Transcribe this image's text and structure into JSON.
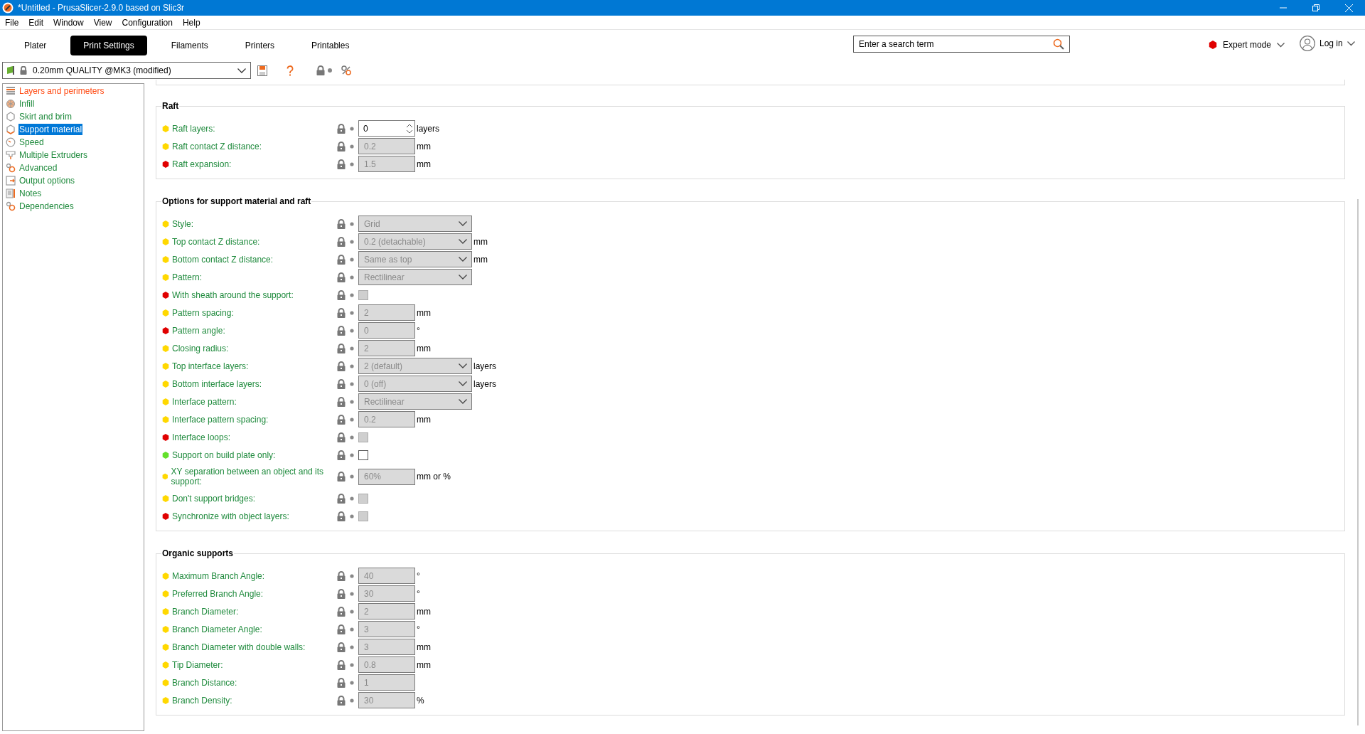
{
  "window": {
    "title": "*Untitled - PrusaSlicer-2.9.0 based on Slic3r"
  },
  "menu": [
    "File",
    "Edit",
    "Window",
    "View",
    "Configuration",
    "Help"
  ],
  "tabs": [
    {
      "label": "Plater",
      "selected": false
    },
    {
      "label": "Print Settings",
      "selected": true
    },
    {
      "label": "Filaments",
      "selected": false
    },
    {
      "label": "Printers",
      "selected": false
    },
    {
      "label": "Printables",
      "selected": false
    }
  ],
  "search": {
    "placeholder": "Enter a search term"
  },
  "mode": {
    "label": "Expert mode",
    "color": "#e00000"
  },
  "account": {
    "label": "Log in"
  },
  "preset": {
    "value": "0.20mm QUALITY @MK3 (modified)"
  },
  "sidebar": {
    "items": [
      {
        "label": "Layers and perimeters",
        "modified": true,
        "selected": false
      },
      {
        "label": "Infill",
        "modified": false,
        "selected": false
      },
      {
        "label": "Skirt and brim",
        "modified": false,
        "selected": false
      },
      {
        "label": "Support material",
        "modified": false,
        "selected": true
      },
      {
        "label": "Speed",
        "modified": false,
        "selected": false
      },
      {
        "label": "Multiple Extruders",
        "modified": false,
        "selected": false
      },
      {
        "label": "Advanced",
        "modified": false,
        "selected": false
      },
      {
        "label": "Output options",
        "modified": false,
        "selected": false
      },
      {
        "label": "Notes",
        "modified": false,
        "selected": false
      },
      {
        "label": "Dependencies",
        "modified": false,
        "selected": false
      }
    ]
  },
  "sections": [
    {
      "title": "Raft",
      "rows": [
        {
          "label": "Raft layers:",
          "color": "#ffd800",
          "kind": "spin",
          "value": "0",
          "unit": "layers",
          "disabled": false
        },
        {
          "label": "Raft contact Z distance:",
          "color": "#ffd800",
          "kind": "text",
          "value": "0.2",
          "unit": "mm",
          "disabled": true
        },
        {
          "label": "Raft expansion:",
          "color": "#e00000",
          "kind": "text",
          "value": "1.5",
          "unit": "mm",
          "disabled": true
        }
      ]
    },
    {
      "title": "Options for support material and raft",
      "rows": [
        {
          "label": "Style:",
          "color": "#ffd800",
          "kind": "select",
          "value": "Grid",
          "disabled": true
        },
        {
          "label": "Top contact Z distance:",
          "color": "#ffd800",
          "kind": "select",
          "value": "0.2 (detachable)",
          "unit": "mm",
          "disabled": true
        },
        {
          "label": "Bottom contact Z distance:",
          "color": "#ffd800",
          "kind": "select",
          "value": "Same as top",
          "unit": "mm",
          "disabled": true
        },
        {
          "label": "Pattern:",
          "color": "#ffd800",
          "kind": "select",
          "value": "Rectilinear",
          "disabled": true
        },
        {
          "label": "With sheath around the support:",
          "color": "#e00000",
          "kind": "checkbox",
          "checked": false,
          "disabled": true
        },
        {
          "label": "Pattern spacing:",
          "color": "#ffd800",
          "kind": "text",
          "value": "2",
          "unit": "mm",
          "disabled": true
        },
        {
          "label": "Pattern angle:",
          "color": "#e00000",
          "kind": "text",
          "value": "0",
          "unit": "°",
          "disabled": true
        },
        {
          "label": "Closing radius:",
          "color": "#ffd800",
          "kind": "text",
          "value": "2",
          "unit": "mm",
          "disabled": true
        },
        {
          "label": "Top interface layers:",
          "color": "#ffd800",
          "kind": "select",
          "value": "2 (default)",
          "unit": "layers",
          "disabled": true
        },
        {
          "label": "Bottom interface layers:",
          "color": "#ffd800",
          "kind": "select",
          "value": "0 (off)",
          "unit": "layers",
          "disabled": true
        },
        {
          "label": "Interface pattern:",
          "color": "#ffd800",
          "kind": "select",
          "value": "Rectilinear",
          "disabled": true
        },
        {
          "label": "Interface pattern spacing:",
          "color": "#ffd800",
          "kind": "text",
          "value": "0.2",
          "unit": "mm",
          "disabled": true
        },
        {
          "label": "Interface loops:",
          "color": "#e00000",
          "kind": "checkbox",
          "checked": false,
          "disabled": true
        },
        {
          "label": "Support on build plate only:",
          "color": "#63e02a",
          "kind": "checkbox",
          "checked": false,
          "disabled": false
        },
        {
          "label": "XY separation between an object and its support:",
          "color": "#ffd800",
          "kind": "text",
          "value": "60%",
          "unit": "mm or %",
          "disabled": true
        },
        {
          "label": "Don't support bridges:",
          "color": "#ffd800",
          "kind": "checkbox",
          "checked": false,
          "disabled": true
        },
        {
          "label": "Synchronize with object layers:",
          "color": "#e00000",
          "kind": "checkbox",
          "checked": false,
          "disabled": true
        }
      ]
    },
    {
      "title": "Organic supports",
      "rows": [
        {
          "label": "Maximum Branch Angle:",
          "color": "#ffd800",
          "kind": "text",
          "value": "40",
          "unit": "°",
          "disabled": true
        },
        {
          "label": "Preferred Branch Angle:",
          "color": "#ffd800",
          "kind": "text",
          "value": "30",
          "unit": "°",
          "disabled": true
        },
        {
          "label": "Branch Diameter:",
          "color": "#ffd800",
          "kind": "text",
          "value": "2",
          "unit": "mm",
          "disabled": true
        },
        {
          "label": "Branch Diameter Angle:",
          "color": "#ffd800",
          "kind": "text",
          "value": "3",
          "unit": "°",
          "disabled": true
        },
        {
          "label": "Branch Diameter with double walls:",
          "color": "#ffd800",
          "kind": "text",
          "value": "3",
          "unit": "mm",
          "disabled": true
        },
        {
          "label": "Tip Diameter:",
          "color": "#ffd800",
          "kind": "text",
          "value": "0.8",
          "unit": "mm",
          "disabled": true
        },
        {
          "label": "Branch Distance:",
          "color": "#ffd800",
          "kind": "text",
          "value": "1",
          "disabled": true
        },
        {
          "label": "Branch Density:",
          "color": "#ffd800",
          "kind": "text",
          "value": "30",
          "unit": "%",
          "disabled": true
        }
      ]
    }
  ]
}
